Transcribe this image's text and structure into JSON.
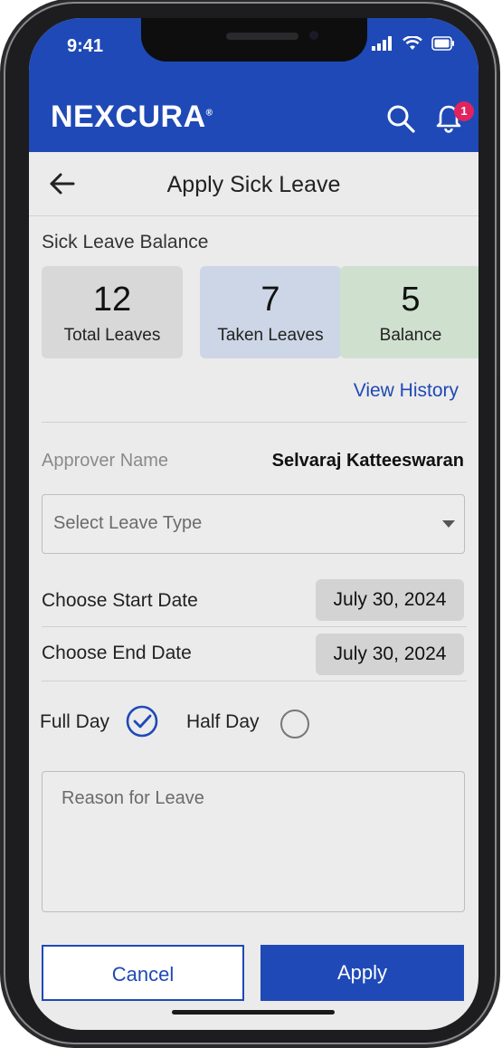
{
  "status_bar": {
    "time": "9:41"
  },
  "app_bar": {
    "brand": "NEXCURA",
    "brand_mark": "®",
    "notification_count": "1",
    "icons": [
      "search-icon",
      "bell-icon"
    ]
  },
  "header": {
    "title": "Apply Sick Leave",
    "back_icon": "arrow-left-icon"
  },
  "balance": {
    "heading": "Sick Leave Balance",
    "cards": [
      {
        "value": "12",
        "label": "Total Leaves",
        "color": "#d8d8d8"
      },
      {
        "value": "7",
        "label": "Taken Leaves",
        "color": "#ccd6e6"
      },
      {
        "value": "5",
        "label": "Balance",
        "color": "#cfe0cf"
      }
    ],
    "view_history": "View History"
  },
  "form": {
    "approver_label": "Approver Name",
    "approver_value": "Selvaraj Katteeswaran",
    "leave_type_placeholder": "Select Leave Type",
    "start_label": "Choose Start Date",
    "start_value": "July 30, 2024",
    "end_label": "Choose End Date",
    "end_value": "July 30, 2024",
    "full_day_label": "Full Day",
    "full_day_selected": true,
    "half_day_label": "Half Day",
    "half_day_selected": false,
    "reason_placeholder": "Reason for Leave"
  },
  "actions": {
    "cancel": "Cancel",
    "apply": "Apply"
  },
  "theme": {
    "primary": "#1f49b6",
    "badge": "#e0245e",
    "background": "#ebebeb"
  }
}
